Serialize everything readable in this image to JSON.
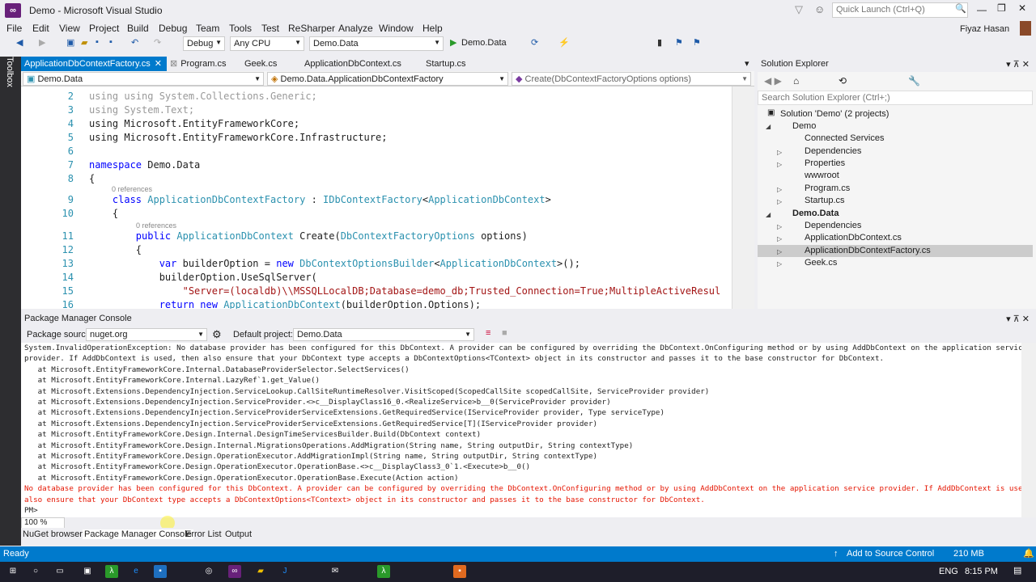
{
  "window": {
    "title": "Demo - Microsoft Visual Studio",
    "quick_launch": "Quick Launch (Ctrl+Q)",
    "user": "Fiyaz Hasan"
  },
  "menu": [
    "File",
    "Edit",
    "View",
    "Project",
    "Build",
    "Debug",
    "Team",
    "Tools",
    "Test",
    "ReSharper",
    "Analyze",
    "Window",
    "Help"
  ],
  "toolbar": {
    "config": "Debug",
    "platform": "Any CPU",
    "startup": "Demo.Data",
    "run_label": "Demo.Data"
  },
  "toolbox": "Toolbox",
  "doc_tabs": [
    "ApplicationDbContextFactory.cs",
    "Program.cs",
    "Geek.cs",
    "ApplicationDbContext.cs",
    "Startup.cs"
  ],
  "nav": {
    "project": "Demo.Data",
    "type": "Demo.Data.ApplicationDbContextFactory",
    "member": "Create(DbContextFactoryOptions options)"
  },
  "code": {
    "l2": "using System.Collections.Generic;",
    "l3": "using System.Text;",
    "l4": "using Microsoft.EntityFrameworkCore;",
    "l5": "using Microsoft.EntityFrameworkCore.Infrastructure;",
    "l7a": "namespace",
    "l7b": " Demo.Data",
    "lens": "0 references",
    "l9a": "class ",
    "l9b": "ApplicationDbContextFactory",
    " l9c": "",
    "l11": "public",
    "l13": "var builderOption = new DbContextOptionsBuilder<ApplicationDbContext>();",
    "l14": "builderOption.UseSqlServer(",
    "l15": "\"Server=(localdb)\\\\MSSQLLocalDB;Database=demo_db;Trusted_Connection=True;MultipleActiveResul",
    "l16": "return new ApplicationDbContext(builderOption.Options);"
  },
  "solution_explorer": {
    "title": "Solution Explorer",
    "search": "Search Solution Explorer (Ctrl+;)",
    "items": [
      "Solution 'Demo' (2 projects)",
      "Demo",
      "Connected Services",
      "Dependencies",
      "Properties",
      "wwwroot",
      "Program.cs",
      "Startup.cs",
      "Demo.Data",
      "Dependencies",
      "ApplicationDbContext.cs",
      "ApplicationDbContextFactory.cs",
      "Geek.cs"
    ]
  },
  "pmc": {
    "title": "Package Manager Console",
    "source_label": "Package source:",
    "source": "nuget.org",
    "project_label": "Default project:",
    "project": "Demo.Data",
    "zoom": "100 %",
    "lines": [
      "System.InvalidOperationException: No database provider has been configured for this DbContext. A provider can be configured by overriding the DbContext.OnConfiguring method or by using AddDbContext on the application service",
      "provider. If AddDbContext is used, then also ensure that your DbContext type accepts a DbContextOptions<TContext> object in its constructor and passes it to the base constructor for DbContext.",
      "   at Microsoft.EntityFrameworkCore.Internal.DatabaseProviderSelector.SelectServices()",
      "   at Microsoft.EntityFrameworkCore.Internal.LazyRef`1.get_Value()",
      "   at Microsoft.Extensions.DependencyInjection.ServiceLookup.CallSiteRuntimeResolver.VisitScoped(ScopedCallSite scopedCallSite, ServiceProvider provider)",
      "   at Microsoft.Extensions.DependencyInjection.ServiceProvider.<>c__DisplayClass16_0.<RealizeService>b__0(ServiceProvider provider)",
      "   at Microsoft.Extensions.DependencyInjection.ServiceProviderServiceExtensions.GetRequiredService(IServiceProvider provider, Type serviceType)",
      "   at Microsoft.Extensions.DependencyInjection.ServiceProviderServiceExtensions.GetRequiredService[T](IServiceProvider provider)",
      "   at Microsoft.EntityFrameworkCore.Design.Internal.DesignTimeServicesBuilder.Build(DbContext context)",
      "   at Microsoft.EntityFrameworkCore.Design.Internal.MigrationsOperations.AddMigration(String name, String outputDir, String contextType)",
      "   at Microsoft.EntityFrameworkCore.Design.OperationExecutor.AddMigrationImpl(String name, String outputDir, String contextType)",
      "   at Microsoft.EntityFrameworkCore.Design.OperationExecutor.OperationBase.<>c__DisplayClass3_0`1.<Execute>b__0()",
      "   at Microsoft.EntityFrameworkCore.Design.OperationExecutor.OperationBase.Execute(Action action)"
    ],
    "errors": [
      "No database provider has been configured for this DbContext. A provider can be configured by overriding the DbContext.OnConfiguring method or by using AddDbContext on the application service provider. If AddDbContext is used, then",
      "also ensure that your DbContext type accepts a DbContextOptions<TContext> object in its constructor and passes it to the base constructor for DbContext."
    ],
    "prompt": "PM>"
  },
  "bottom_tabs": [
    "NuGet browser",
    "Package Manager Console",
    "Error List",
    "Output"
  ],
  "status": {
    "ready": "Ready",
    "source_control": "Add to Source Control",
    "memory": "210 MB"
  },
  "taskbar": {
    "lang": "ENG",
    "time": "8:15 PM"
  }
}
